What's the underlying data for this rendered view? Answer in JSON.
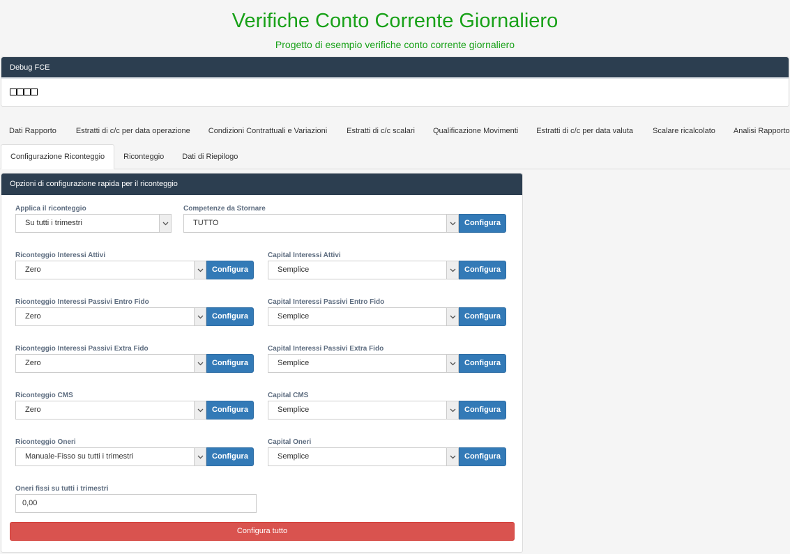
{
  "header": {
    "title": "Verifiche Conto Corrente Giornaliero",
    "subtitle": "Progetto di esempio verifiche conto corrente giornaliero"
  },
  "debug": {
    "title": "Debug FCE",
    "content": "□□□□"
  },
  "tabs_row1": [
    "Dati Rapporto",
    "Estratti di c/c per data operazione",
    "Condizioni Contrattuali e Variazioni",
    "Estratti di c/c scalari",
    "Qualificazione Movimenti",
    "Estratti di c/c per data valuta",
    "Scalare ricalcolato",
    "Analisi Rapporto"
  ],
  "tabs_row2": [
    "Configurazione Riconteggio",
    "Riconteggio",
    "Dati di Riepilogo"
  ],
  "active_tab": "Configurazione Riconteggio",
  "panel": {
    "title": "Opzioni di configurazione rapida per il riconteggio",
    "configure_label": "Configura",
    "configure_all_label": "Configura tutto",
    "fields": {
      "applica": {
        "label": "Applica il riconteggio",
        "value": "Su tutti i trimestri"
      },
      "competenze": {
        "label": "Competenze da Stornare",
        "value": "TUTTO"
      },
      "ric_int_attivi": {
        "label": "Riconteggio Interessi Attivi",
        "value": "Zero"
      },
      "cap_int_attivi": {
        "label": "Capital Interessi Attivi",
        "value": "Semplice"
      },
      "ric_int_pass_entro": {
        "label": "Riconteggio Interessi Passivi Entro Fido",
        "value": "Zero"
      },
      "cap_int_pass_entro": {
        "label": "Capital Interessi Passivi Entro Fido",
        "value": "Semplice"
      },
      "ric_int_pass_extra": {
        "label": "Riconteggio Interessi Passivi Extra Fido",
        "value": "Zero"
      },
      "cap_int_pass_extra": {
        "label": "Capital Interessi Passivi Extra Fido",
        "value": "Semplice"
      },
      "ric_cms": {
        "label": "Riconteggio CMS",
        "value": "Zero"
      },
      "cap_cms": {
        "label": "Capital CMS",
        "value": "Semplice"
      },
      "ric_oneri": {
        "label": "Riconteggio Oneri",
        "value": "Manuale-Fisso su tutti i trimestri"
      },
      "cap_oneri": {
        "label": "Capital Oneri",
        "value": "Semplice"
      },
      "oneri_fissi": {
        "label": "Oneri fissi su tutti i trimestri",
        "value": "0,00"
      }
    }
  },
  "colors": {
    "title_green": "#18a118",
    "header_bg": "#2c3e50",
    "primary_btn": "#337ab7",
    "danger_btn": "#d9534f"
  }
}
